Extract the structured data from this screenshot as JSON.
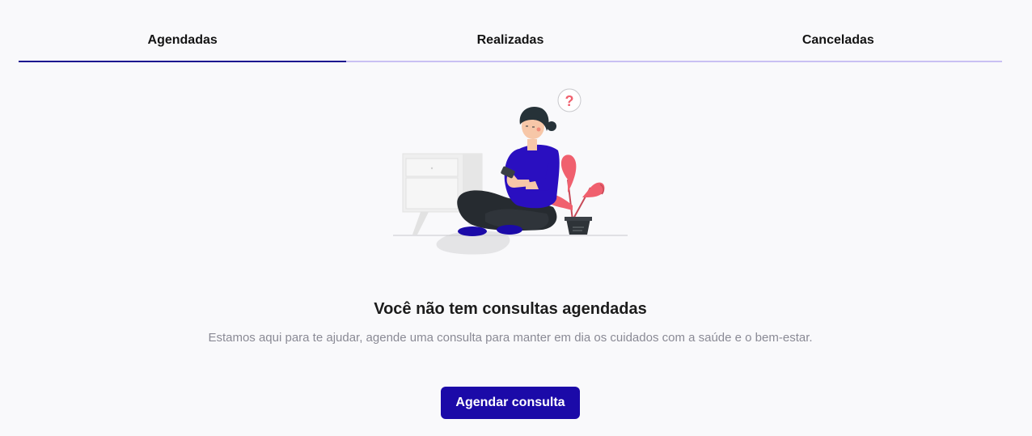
{
  "tabs": [
    {
      "label": "Agendadas",
      "active": true
    },
    {
      "label": "Realizadas",
      "active": false
    },
    {
      "label": "Canceladas",
      "active": false
    }
  ],
  "illustration": {
    "icon": "woman-with-phone-question-illustration",
    "question_mark": "?"
  },
  "empty_state": {
    "title": "Você não tem consultas agendadas",
    "description": "Estamos aqui para te ajudar, agende uma consulta para manter em dia os cuidados com a saúde e o bem-estar.",
    "button_label": "Agendar consulta"
  },
  "colors": {
    "accent": "#1b0aa8",
    "tab_active_underline": "#1b0f8f",
    "tab_inactive_underline": "#c9c0f3",
    "plant": "#f0606e",
    "background": "#f9f9fb"
  }
}
